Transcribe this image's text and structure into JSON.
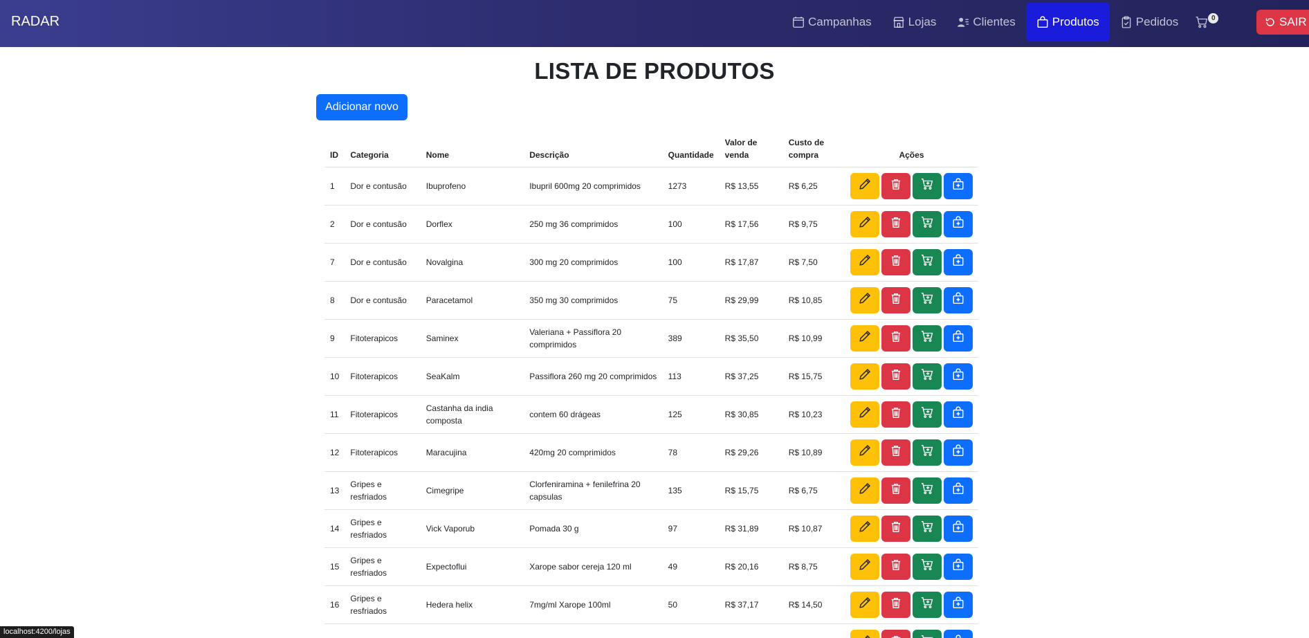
{
  "navbar": {
    "brand": "RADAR",
    "items": [
      {
        "label": "Campanhas",
        "icon": "calendar-icon"
      },
      {
        "label": "Lojas",
        "icon": "shop-icon"
      },
      {
        "label": "Clientes",
        "icon": "person-lines-icon"
      },
      {
        "label": "Produtos",
        "icon": "bag-icon"
      },
      {
        "label": "Pedidos",
        "icon": "clipboard-check-icon"
      }
    ],
    "cart_count": "0",
    "logout_label": "SAIR"
  },
  "page": {
    "title": "LISTA DE PRODUTOS",
    "add_label": "Adicionar novo"
  },
  "table": {
    "headers": {
      "id": "ID",
      "categoria": "Categoria",
      "nome": "Nome",
      "descricao": "Descrição",
      "quantidade": "Quantidade",
      "valor_venda": "Valor de venda",
      "custo_compra": "Custo de compra",
      "acoes": "Ações"
    },
    "rows": [
      {
        "id": "1",
        "categoria": "Dor e contusão",
        "nome": "Ibuprofeno",
        "descricao": "Ibupril 600mg 20 comprimidos",
        "quantidade": "1273",
        "valor_venda": "R$ 13,55",
        "custo_compra": "R$ 6,25"
      },
      {
        "id": "2",
        "categoria": "Dor e contusão",
        "nome": "Dorflex",
        "descricao": "250 mg 36 comprimidos",
        "quantidade": "100",
        "valor_venda": "R$ 17,56",
        "custo_compra": "R$ 9,75"
      },
      {
        "id": "7",
        "categoria": "Dor e contusão",
        "nome": "Novalgina",
        "descricao": "300 mg 20 comprimidos",
        "quantidade": "100",
        "valor_venda": "R$ 17,87",
        "custo_compra": "R$ 7,50"
      },
      {
        "id": "8",
        "categoria": "Dor e contusão",
        "nome": "Paracetamol",
        "descricao": "350 mg 30 comprimidos",
        "quantidade": "75",
        "valor_venda": "R$ 29,99",
        "custo_compra": "R$ 10,85"
      },
      {
        "id": "9",
        "categoria": "Fitoterapicos",
        "nome": "Saminex",
        "descricao": "Valeriana + Passiflora 20 comprimidos",
        "quantidade": "389",
        "valor_venda": "R$ 35,50",
        "custo_compra": "R$ 10,99"
      },
      {
        "id": "10",
        "categoria": "Fitoterapicos",
        "nome": "SeaKalm",
        "descricao": "Passiflora 260 mg 20 comprimidos",
        "quantidade": "113",
        "valor_venda": "R$ 37,25",
        "custo_compra": "R$ 15,75"
      },
      {
        "id": "11",
        "categoria": "Fitoterapicos",
        "nome": "Castanha da india composta",
        "descricao": "contem 60 drágeas",
        "quantidade": "125",
        "valor_venda": "R$ 30,85",
        "custo_compra": "R$ 10,23"
      },
      {
        "id": "12",
        "categoria": "Fitoterapicos",
        "nome": "Maracujina",
        "descricao": "420mg 20 comprimidos",
        "quantidade": "78",
        "valor_venda": "R$ 29,26",
        "custo_compra": "R$ 10,89"
      },
      {
        "id": "13",
        "categoria": "Gripes e resfriados",
        "nome": "Cimegripe",
        "descricao": "Clorfeniramina + fenilefrina 20 capsulas",
        "quantidade": "135",
        "valor_venda": "R$ 15,75",
        "custo_compra": "R$ 6,75"
      },
      {
        "id": "14",
        "categoria": "Gripes e resfriados",
        "nome": "Vick Vaporub",
        "descricao": "Pomada 30 g",
        "quantidade": "97",
        "valor_venda": "R$ 31,89",
        "custo_compra": "R$ 10,87"
      },
      {
        "id": "15",
        "categoria": "Gripes e resfriados",
        "nome": "Expectoflui",
        "descricao": "Xarope sabor cereja 120 ml",
        "quantidade": "49",
        "valor_venda": "R$ 20,16",
        "custo_compra": "R$ 8,75"
      },
      {
        "id": "16",
        "categoria": "Gripes e resfriados",
        "nome": "Hedera helix",
        "descricao": "7mg/ml Xarope 100ml",
        "quantidade": "50",
        "valor_venda": "R$ 37,17",
        "custo_compra": "R$ 14,50"
      },
      {
        "id": "",
        "categoria": "",
        "nome": "",
        "descricao": "",
        "quantidade": "",
        "valor_venda": "",
        "custo_compra": ""
      }
    ],
    "action_icons": [
      "pencil-icon",
      "trash-icon",
      "cart-plus-icon",
      "bag-plus-icon"
    ]
  },
  "status_bar": {
    "url": "localhost:4200/lojas"
  },
  "colors": {
    "nav_bg_start": "#3b3d8f",
    "nav_bg_end": "#23235c",
    "nav_active": "#1b1bdc",
    "logout": "#dc3545",
    "primary": "#0d6efd",
    "warning": "#ffc107",
    "danger": "#dc3545",
    "success": "#198754"
  }
}
